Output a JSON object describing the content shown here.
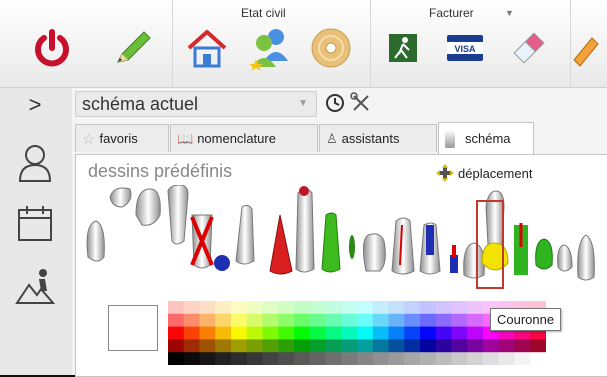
{
  "toolbar": {
    "group_etat_civil": "Etat civil",
    "group_facturer": "Facturer",
    "facturer_dropdown_caret": "▼"
  },
  "panel": {
    "dropdown_value": "schéma actuel",
    "tabs": [
      {
        "label": "favoris"
      },
      {
        "label": "nomenclature"
      },
      {
        "label": "assistants"
      },
      {
        "label": "schéma"
      }
    ],
    "section_title": "dessins prédéfinis",
    "deplacement_label": "déplacement",
    "tooltip": "Couronne"
  },
  "sidebar": {
    "expand_glyph": ">"
  },
  "colors": {
    "power": "#c8102e",
    "selection": "#c0392b"
  }
}
